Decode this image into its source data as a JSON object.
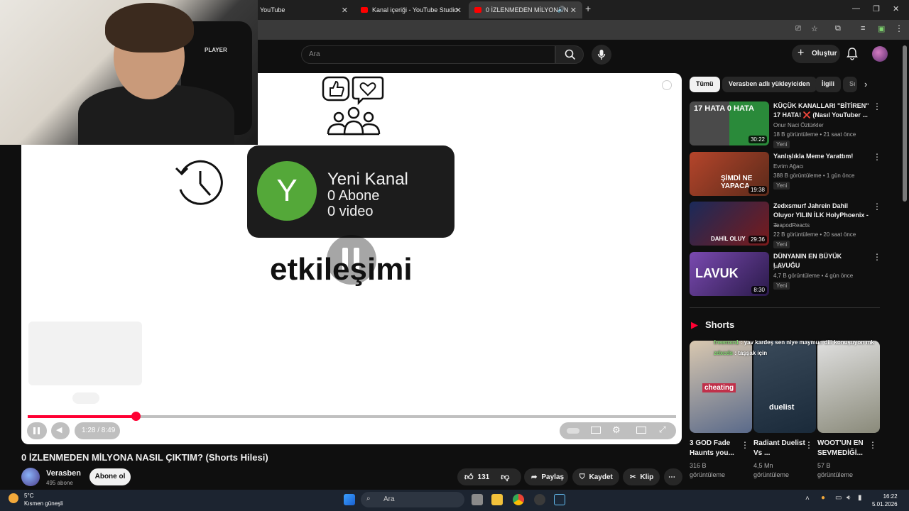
{
  "browser": {
    "tabs": [
      {
        "label": "YouTube"
      },
      {
        "label": "Kanal içeriği - YouTube Studio"
      },
      {
        "label": "0 İZLENMEDEN MİLYONA N"
      }
    ]
  },
  "header": {
    "search_placeholder": "Ara",
    "create_label": "Oluştur"
  },
  "player": {
    "channel_card": {
      "initial": "Y",
      "name": "Yeni Kanal",
      "subs": "0 Abone",
      "videos": "0 video"
    },
    "big_word": "etkileşimi",
    "time": "1:28 / 8:49",
    "progress_fraction": 0.167
  },
  "video": {
    "title": "0 İZLENMEDEN MİLYONA NASIL ÇIKTIM? (Shorts Hilesi)",
    "channel": "Verasben",
    "subscribers": "495 abone",
    "subscribe_label": "Abone ol",
    "likes": "131",
    "share_label": "Paylaş",
    "save_label": "Kaydet",
    "clip_label": "Klip"
  },
  "chips": [
    "Tümü",
    "Verasben adlı yükleyiciden",
    "İlgili",
    "Sı"
  ],
  "recommendations": [
    {
      "title": "KÜÇÜK KANALLARI \"BİTİREN\" 17 HATA! ❌ (Nasıl YouTuber ...",
      "channel": "Onur Naci Öztürkler",
      "meta": "18 B görüntüleme • 21 saat önce",
      "badge": "Yeni",
      "duration": "30:22",
      "thumb_text": "17 HATA   0 HATA"
    },
    {
      "title": "Yanlışlıkla Meme Yarattım!",
      "channel": "Evrim Ağacı",
      "meta": "388 B görüntüleme • 1 gün önce",
      "badge": "Yeni",
      "duration": "19:38",
      "thumb_text": "ŞİMDİ NE YAPACA"
    },
    {
      "title": "Zedxsmurf Jahrein Dahil Oluyor YILIN İLK HolyPhoenix - ...",
      "channel": "TeapodReacts",
      "meta": "22 B görüntüleme • 20 saat önce",
      "badge": "Yeni",
      "duration": "29:36",
      "thumb_text": "DAHİL OLUY"
    },
    {
      "title": "DÜNYANIN EN BÜYÜK LAVUĞU",
      "channel": "yuki",
      "meta": "4,7 B görüntüleme • 4 gün önce",
      "badge": "Yeni",
      "duration": "8:30",
      "thumb_text": "LAVUK"
    }
  ],
  "shorts": {
    "heading": "Shorts",
    "chat": [
      {
        "user": "freemxn1",
        "msg": ": yav kardeş sen niye maymun dili konuşuyon mk"
      },
      {
        "user": "zdxcds",
        "msg": ": taşşak için"
      }
    ],
    "items": [
      {
        "title": "3 GOD Fade Haunts you...",
        "views": "316 B görüntüleme",
        "overlay": "cheating"
      },
      {
        "title": "Radiant Duelist Vs ...",
        "views": "4,5 Mn görüntüleme",
        "overlay": "duelist"
      },
      {
        "title": "WOOT'UN EN SEVMEDİĞİ...",
        "views": "57 B görüntüleme",
        "overlay": ""
      }
    ]
  },
  "webcam": {
    "chair_brand": "PLAYER"
  },
  "taskbar": {
    "weather_temp": "5°C",
    "weather_desc": "Kısmen güneşli",
    "search": "Ara",
    "time": "16:22",
    "date": "5.01.2026"
  }
}
